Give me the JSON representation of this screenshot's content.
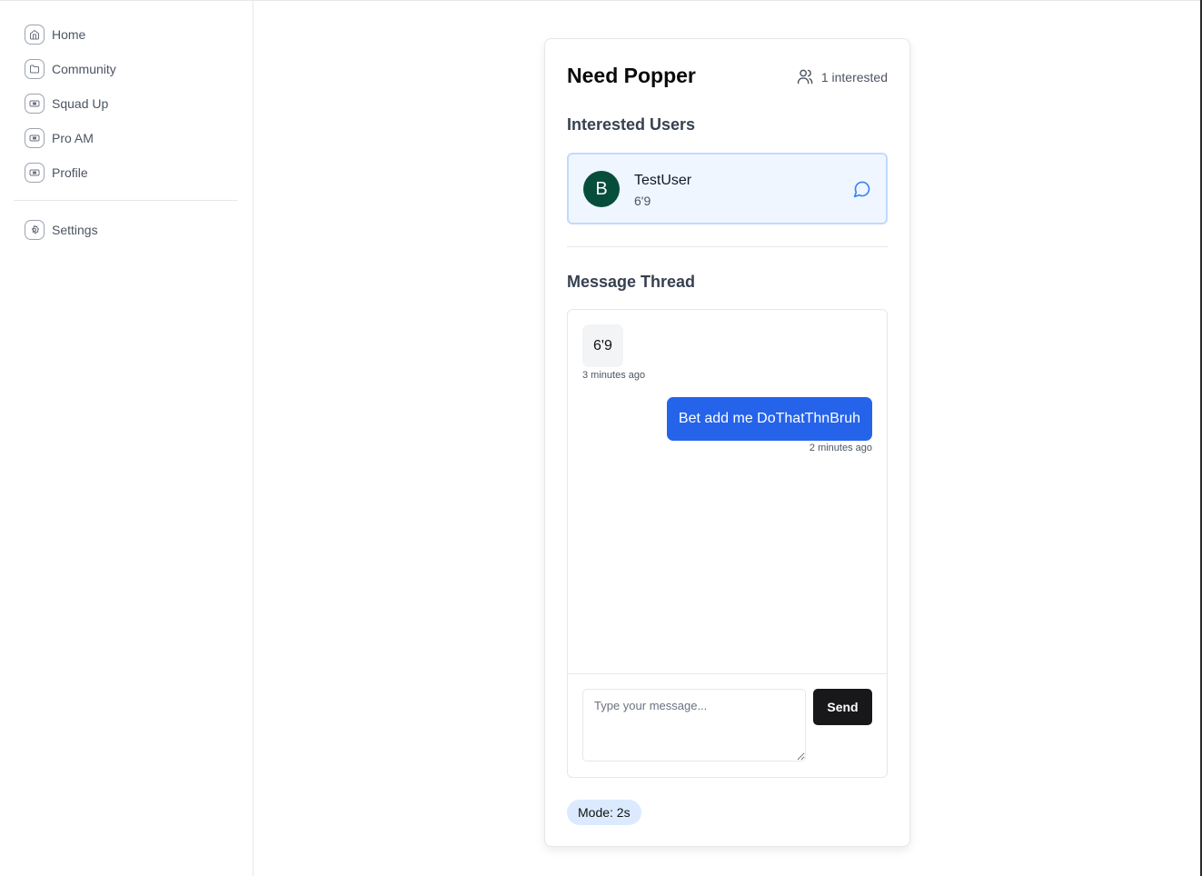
{
  "sidebar": {
    "items": [
      {
        "label": "Home",
        "icon": "home-icon"
      },
      {
        "label": "Community",
        "icon": "folder-icon"
      },
      {
        "label": "Squad Up",
        "icon": "ticket-icon"
      },
      {
        "label": "Pro AM",
        "icon": "ticket-icon"
      },
      {
        "label": "Profile",
        "icon": "ticket-icon"
      }
    ],
    "settings": {
      "label": "Settings",
      "icon": "gear-icon"
    }
  },
  "post": {
    "title": "Need Popper",
    "interested_count": "1 interested",
    "interested_heading": "Interested Users",
    "users": [
      {
        "initial": "B",
        "name": "TestUser",
        "height": "6'9",
        "avatar_color": "#064e3b"
      }
    ],
    "thread_heading": "Message Thread",
    "messages": [
      {
        "text": "6'9",
        "time": "3 minutes ago",
        "direction": "incoming"
      },
      {
        "text": "Bet add me DoThatThnBruh",
        "time": "2 minutes ago",
        "direction": "outgoing"
      }
    ],
    "composer": {
      "placeholder": "Type your message...",
      "value": "",
      "send_label": "Send"
    },
    "mode_badge": "Mode: 2s"
  },
  "colors": {
    "accent": "#2563eb",
    "badge_bg": "#dbeafe",
    "user_card_bg": "#eff6ff"
  }
}
